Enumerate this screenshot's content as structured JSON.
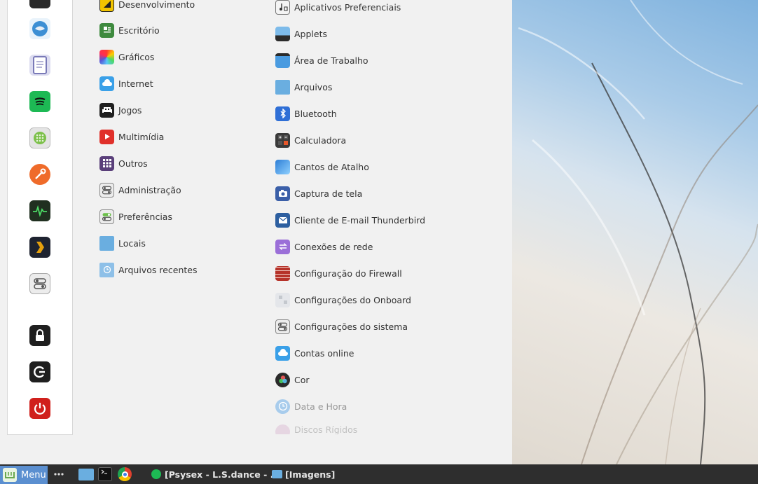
{
  "categories": [
    {
      "label": "Desenvolvimento",
      "icon": "development-icon"
    },
    {
      "label": "Escritório",
      "icon": "office-icon"
    },
    {
      "label": "Gráficos",
      "icon": "graphics-icon"
    },
    {
      "label": "Internet",
      "icon": "internet-icon"
    },
    {
      "label": "Jogos",
      "icon": "games-icon"
    },
    {
      "label": "Multimídia",
      "icon": "multimedia-icon"
    },
    {
      "label": "Outros",
      "icon": "other-icon"
    },
    {
      "label": "Administração",
      "icon": "administration-icon"
    },
    {
      "label": "Preferências",
      "icon": "preferences-icon"
    },
    {
      "label": "Locais",
      "icon": "places-icon"
    },
    {
      "label": "Arquivos recentes",
      "icon": "recent-files-icon"
    }
  ],
  "apps": [
    {
      "label": "Aplicativos Preferenciais",
      "icon": "preferred-apps-icon"
    },
    {
      "label": "Applets",
      "icon": "applets-icon"
    },
    {
      "label": "Área de Trabalho",
      "icon": "desktop-icon"
    },
    {
      "label": "Arquivos",
      "icon": "files-icon"
    },
    {
      "label": "Bluetooth",
      "icon": "bluetooth-icon"
    },
    {
      "label": "Calculadora",
      "icon": "calculator-icon"
    },
    {
      "label": "Cantos de Atalho",
      "icon": "hot-corners-icon"
    },
    {
      "label": "Captura de tela",
      "icon": "screenshot-icon"
    },
    {
      "label": "Cliente de E-mail Thunderbird",
      "icon": "thunderbird-icon"
    },
    {
      "label": "Conexões de rede",
      "icon": "network-icon"
    },
    {
      "label": "Configuração do Firewall",
      "icon": "firewall-icon"
    },
    {
      "label": "Configurações do Onboard",
      "icon": "onboard-icon"
    },
    {
      "label": "Configurações do sistema",
      "icon": "system-settings-icon"
    },
    {
      "label": "Contas online",
      "icon": "online-accounts-icon"
    },
    {
      "label": "Cor",
      "icon": "color-icon"
    },
    {
      "label": "Data e Hora",
      "icon": "date-time-icon"
    },
    {
      "label": "Discos Rígidos",
      "icon": "disks-icon"
    }
  ],
  "favorites": [
    "thunderbird-icon",
    "document-icon",
    "spotify-icon",
    "calculator-icon",
    "tools-icon",
    "system-monitor-icon",
    "plex-icon",
    "settings-icon",
    "lock-icon",
    "logout-icon",
    "power-icon"
  ],
  "taskbar": {
    "menu_label": "Menu",
    "task_spotify": "[Psysex - L.S.dance - ...",
    "task_images": "[Imagens]"
  },
  "colors": {
    "menu_button": "#5b8fd0",
    "panel": "#2e2e2e",
    "menu_background": "#f1f1f1"
  }
}
